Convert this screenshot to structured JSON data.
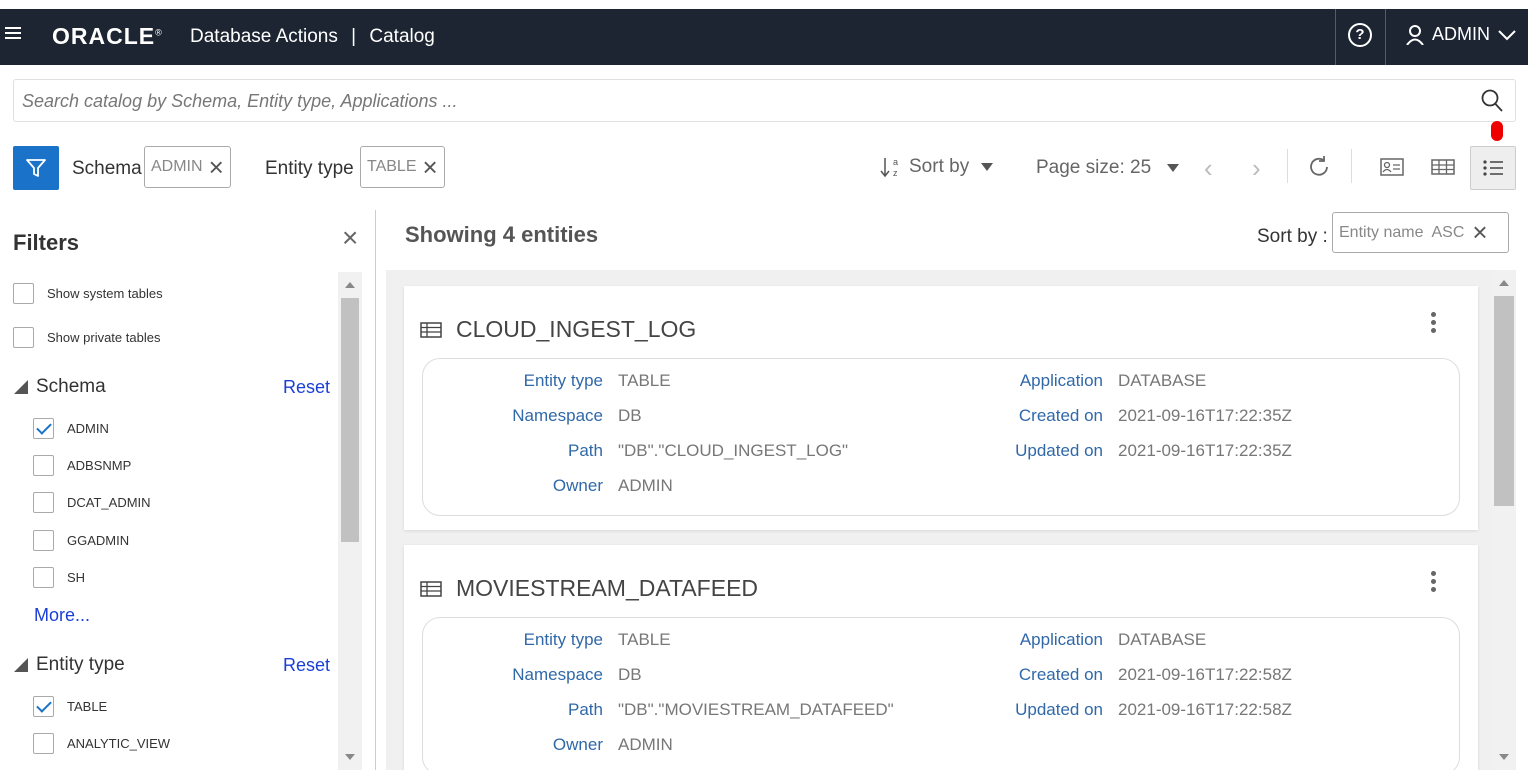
{
  "header": {
    "logo": "ORACLE",
    "app_title": "Database Actions",
    "separator": "|",
    "page": "Catalog",
    "help_symbol": "?",
    "user": "ADMIN"
  },
  "search": {
    "placeholder": "Search catalog by Schema, Entity type, Applications ..."
  },
  "toolbar": {
    "schema_label": "Schema",
    "schema_value": "ADMIN",
    "entity_type_label": "Entity type",
    "entity_type_value": "TABLE",
    "sort_by": "Sort by",
    "page_size": "Page size: 25",
    "prev_symbol": "‹",
    "next_symbol": "›",
    "close_symbol": "×"
  },
  "sidebar": {
    "title": "Filters",
    "show_system_tables": "Show system tables",
    "show_private_tables": "Show private tables",
    "schema_section": "Schema",
    "reset": "Reset",
    "schemas": [
      {
        "label": "ADMIN",
        "checked": true
      },
      {
        "label": "ADBSNMP",
        "checked": false
      },
      {
        "label": "DCAT_ADMIN",
        "checked": false
      },
      {
        "label": "GGADMIN",
        "checked": false
      },
      {
        "label": "SH",
        "checked": false
      }
    ],
    "more": "More...",
    "entity_type_section": "Entity type",
    "entity_types": [
      {
        "label": "TABLE",
        "checked": true
      },
      {
        "label": "ANALYTIC_VIEW",
        "checked": false
      }
    ]
  },
  "main": {
    "showing": "Showing 4 entities",
    "sort_by_label": "Sort by :",
    "sort_chip": "Entity name  ASC",
    "labels": {
      "entity_type": "Entity type",
      "namespace": "Namespace",
      "path": "Path",
      "owner": "Owner",
      "application": "Application",
      "created_on": "Created on",
      "updated_on": "Updated on"
    },
    "entities": [
      {
        "name": "CLOUD_INGEST_LOG",
        "entity_type": "TABLE",
        "namespace": "DB",
        "path": "\"DB\".\"CLOUD_INGEST_LOG\"",
        "owner": "ADMIN",
        "application": "DATABASE",
        "created_on": "2021-09-16T17:22:35Z",
        "updated_on": "2021-09-16T17:22:35Z"
      },
      {
        "name": "MOVIESTREAM_DATAFEED",
        "entity_type": "TABLE",
        "namespace": "DB",
        "path": "\"DB\".\"MOVIESTREAM_DATAFEED\"",
        "owner": "ADMIN",
        "application": "DATABASE",
        "created_on": "2021-09-16T17:22:58Z",
        "updated_on": "2021-09-16T17:22:58Z"
      }
    ]
  },
  "colors": {
    "header_bg": "#1c2531",
    "accent": "#1a73c8",
    "link": "#1a3fd6",
    "label": "#3068a8"
  }
}
